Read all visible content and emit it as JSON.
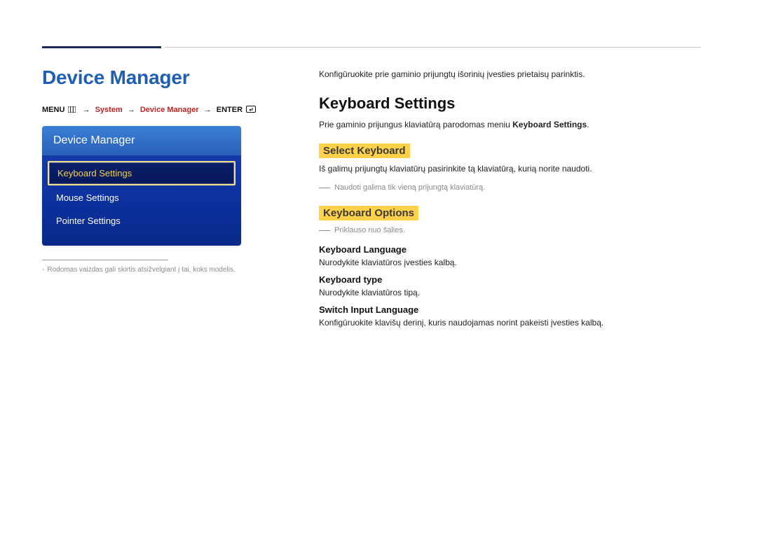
{
  "pageTitle": "Device Manager",
  "breadcrumb": {
    "menu": "MENU",
    "system": "System",
    "deviceManager": "Device Manager",
    "enter": "ENTER",
    "arrow": "→"
  },
  "panel": {
    "header": "Device Manager",
    "items": [
      {
        "label": "Keyboard Settings",
        "selected": true
      },
      {
        "label": "Mouse Settings",
        "selected": false
      },
      {
        "label": "Pointer Settings",
        "selected": false
      }
    ]
  },
  "footnote": "Rodomas vaizdas gali skirtis atsižvelgiant į tai, koks modelis.",
  "intro": "Konfigūruokite prie gaminio prijungtų išorinių įvesties prietaisų parinktis.",
  "keyboardSettings": {
    "title": "Keyboard Settings",
    "desc_pre": "Prie gaminio prijungus klaviatūrą parodomas meniu ",
    "desc_bold": "Keyboard Settings",
    "desc_post": "."
  },
  "selectKeyboard": {
    "title": "Select Keyboard",
    "desc": "Iš galimų prijungtų klaviatūrų pasirinkite tą klaviatūrą, kurią norite naudoti.",
    "note": "Naudoti galima tik vieną prijungtą klaviatūrą."
  },
  "keyboardOptions": {
    "title": "Keyboard Options",
    "note": "Priklauso nuo šalies.",
    "items": [
      {
        "h": "Keyboard Language",
        "p": "Nurodykite klaviatūros įvesties kalbą."
      },
      {
        "h": "Keyboard type",
        "p": "Nurodykite klaviatūros tipą."
      },
      {
        "h": "Switch Input Language",
        "p": "Konfigūruokite klavišų derinį, kuris naudojamas norint pakeisti įvesties kalbą."
      }
    ]
  }
}
